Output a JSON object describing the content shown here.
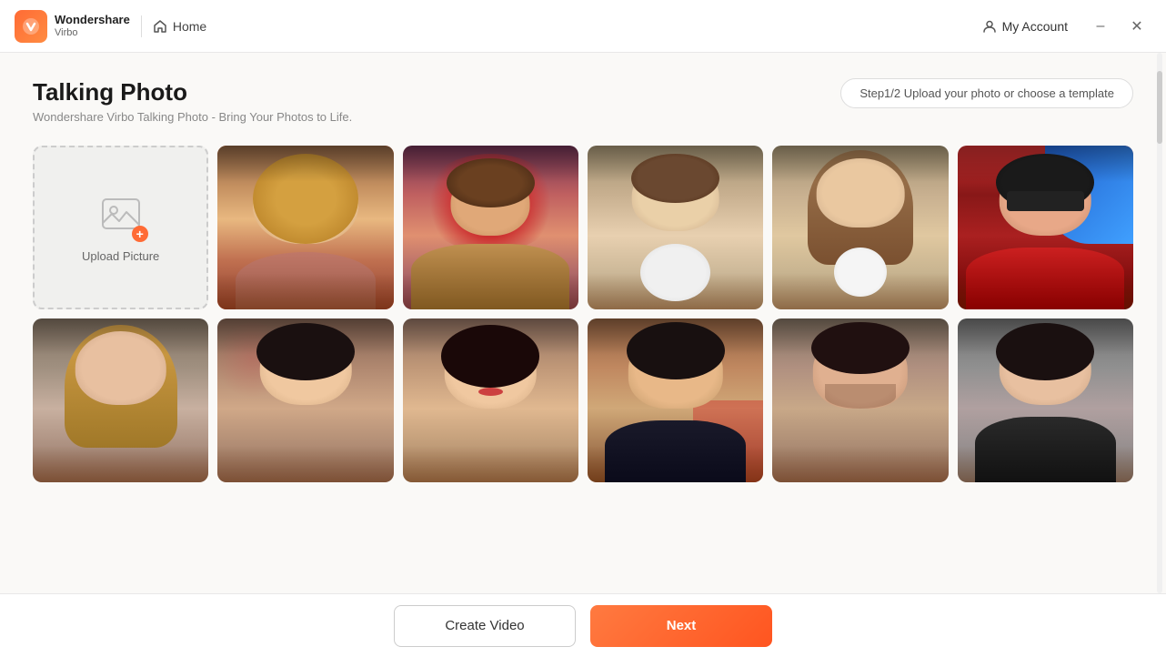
{
  "app": {
    "name": "Wondershare",
    "product": "Virbo",
    "logo_char": "V"
  },
  "titlebar": {
    "home_label": "Home",
    "my_account_label": "My Account",
    "minimize_label": "–",
    "close_label": "✕"
  },
  "page": {
    "title": "Talking Photo",
    "subtitle": "Wondershare Virbo Talking Photo - Bring Your Photos to Life.",
    "step_badge": "Step1/2 Upload your photo or choose a template"
  },
  "grid": {
    "upload_label": "Upload Picture",
    "cards": [
      {
        "id": 1,
        "selected": true,
        "color_class": "card-1"
      },
      {
        "id": 2,
        "selected": false,
        "color_class": "card-2"
      },
      {
        "id": 3,
        "selected": false,
        "color_class": "card-3"
      },
      {
        "id": 4,
        "selected": false,
        "color_class": "card-4"
      },
      {
        "id": 5,
        "selected": false,
        "color_class": "card-5"
      },
      {
        "id": 6,
        "selected": false,
        "color_class": "card-6"
      },
      {
        "id": 7,
        "selected": false,
        "color_class": "card-7"
      },
      {
        "id": 8,
        "selected": false,
        "color_class": "card-8"
      },
      {
        "id": 9,
        "selected": false,
        "color_class": "card-9"
      },
      {
        "id": 10,
        "selected": false,
        "color_class": "card-10"
      },
      {
        "id": 11,
        "selected": false,
        "color_class": "card-11"
      }
    ]
  },
  "bottombar": {
    "create_video_label": "Create Video",
    "next_label": "Next"
  }
}
